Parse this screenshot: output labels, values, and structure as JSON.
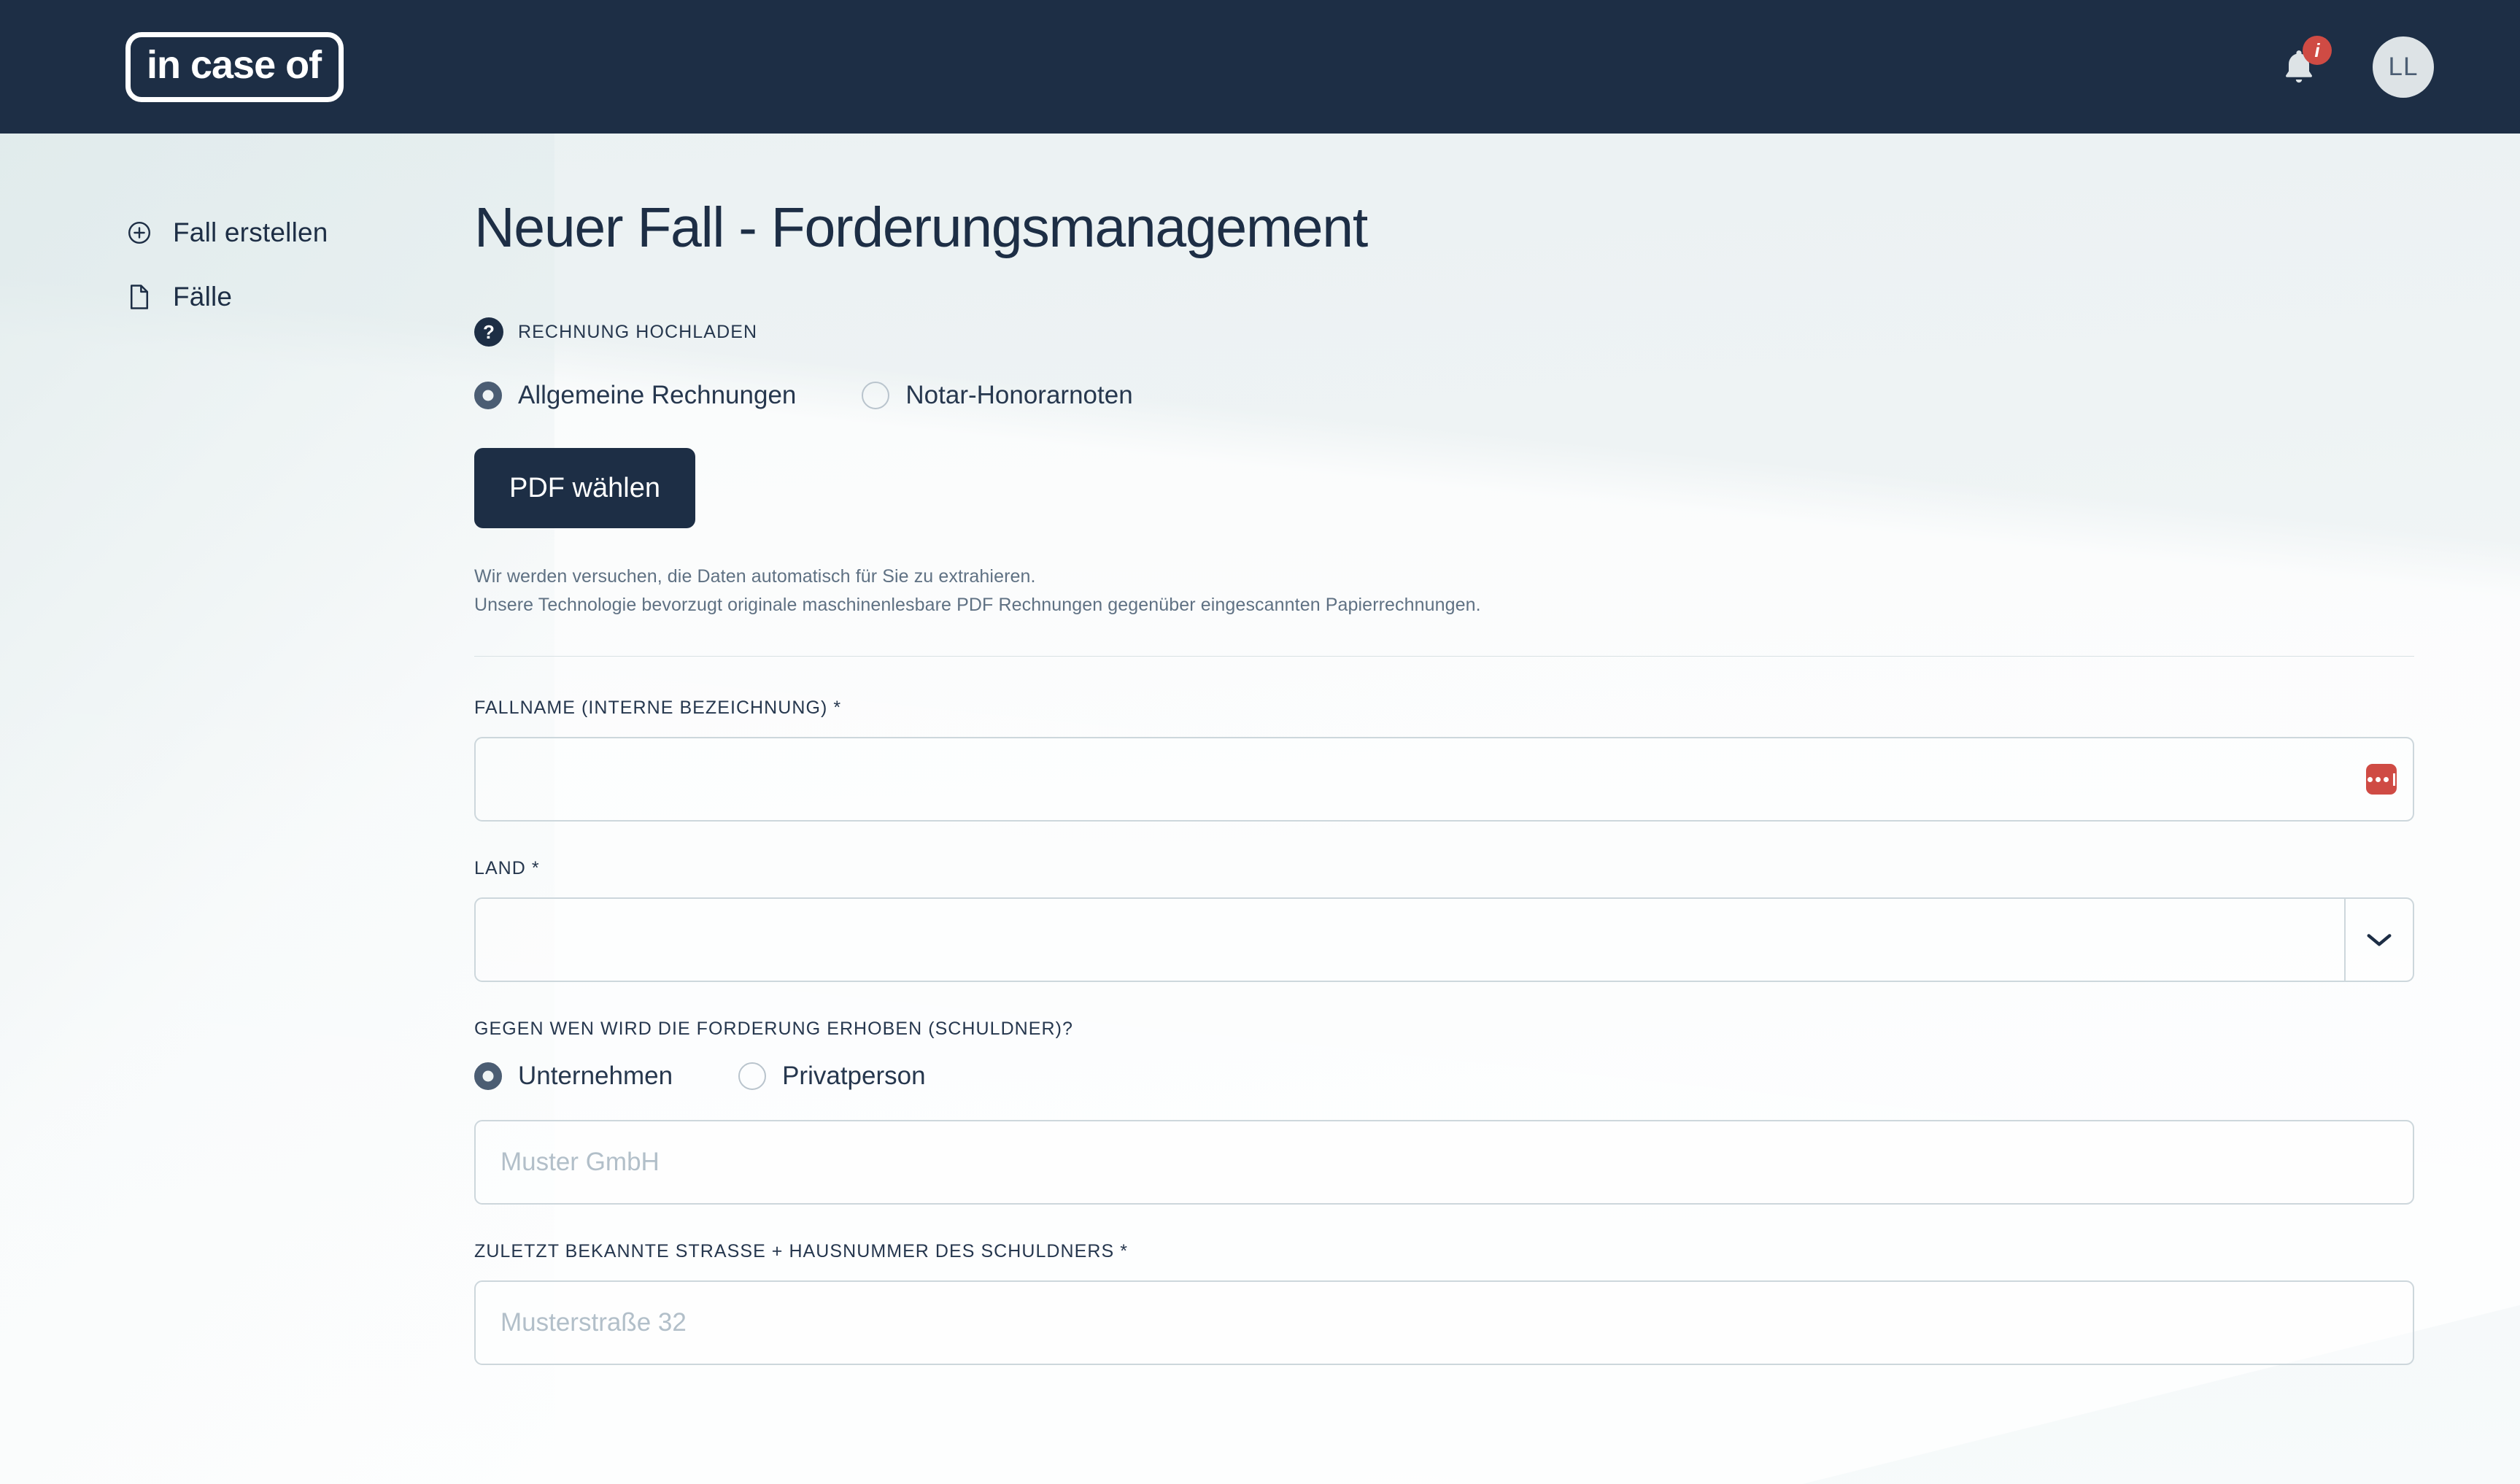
{
  "header": {
    "logo_text": "in case of",
    "notification_badge": "i",
    "notification_icon": "bell-icon",
    "avatar_initials": "LL"
  },
  "sidebar": {
    "items": [
      {
        "label": "Fall erstellen",
        "icon": "plus-circle-icon"
      },
      {
        "label": "Fälle",
        "icon": "document-icon"
      }
    ]
  },
  "main": {
    "page_title": "Neuer Fall - Forderungsmanagement",
    "upload": {
      "help_glyph": "?",
      "section_label": "RECHNUNG HOCHLADEN",
      "options": [
        {
          "label": "Allgemeine Rechnungen",
          "selected": true
        },
        {
          "label": "Notar-Honorarnoten",
          "selected": false
        }
      ],
      "button_label": "PDF wählen",
      "helper_line_1": "Wir werden versuchen, die Daten automatisch für Sie zu extrahieren.",
      "helper_line_2": "Unsere Technologie bevorzugt originale maschinenlesbare PDF Rechnungen gegenüber eingescannten Papierrechnungen."
    },
    "fields": {
      "case_name": {
        "label": "FALLNAME (INTERNE BEZEICHNUNG)",
        "required_mark": "*",
        "value": "",
        "placeholder": "",
        "trailing_icon": "password-manager-icon"
      },
      "country": {
        "label": "LAND",
        "required_mark": "*",
        "value": "",
        "arrow_icon": "chevron-down-icon"
      },
      "debtor_type": {
        "label": "GEGEN WEN WIRD DIE FORDERUNG ERHOBEN (SCHULDNER)?",
        "options": [
          {
            "label": "Unternehmen",
            "selected": true
          },
          {
            "label": "Privatperson",
            "selected": false
          }
        ]
      },
      "debtor_name": {
        "value": "",
        "placeholder": "Muster GmbH"
      },
      "debtor_street": {
        "label": "ZULETZT BEKANNTE STRASSE + HAUSNUMMER DES SCHULDNERS",
        "required_mark": "*",
        "value": "",
        "placeholder": "Musterstraße 32"
      }
    }
  },
  "colors": {
    "navy": "#1d2e45",
    "accent_red": "#cf4b44",
    "slate": "#4b5d73",
    "page_bg": "#eef3f4",
    "border": "#cdd7dc"
  }
}
